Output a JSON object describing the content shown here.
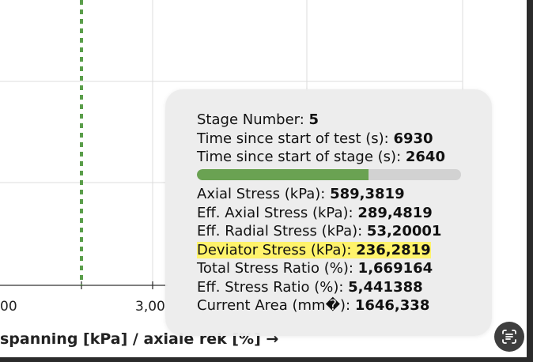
{
  "chart_data": {
    "type": "line",
    "x_tick_labels": [
      "00",
      "3,00"
    ],
    "xlabel_visible": "spanning [kPa] / axiale rek [%] →",
    "grid": true,
    "marker_line": {
      "style": "dashed",
      "color": "#5a9e4a"
    }
  },
  "tooltip": {
    "stage_number": {
      "label": "Stage Number: ",
      "value": "5"
    },
    "time_test": {
      "label": "Time since start of test (s): ",
      "value": "6930"
    },
    "time_stage": {
      "label": "Time since start of stage (s): ",
      "value": "2640"
    },
    "stage_progress": 0.65,
    "axial_stress": {
      "label": "Axial Stress (kPa): ",
      "value": "589,3819"
    },
    "eff_axial_stress": {
      "label": "Eff. Axial Stress (kPa): ",
      "value": "289,4819"
    },
    "eff_radial_stress": {
      "label": "Eff. Radial Stress (kPa): ",
      "value": "53,20001"
    },
    "deviator_stress": {
      "label": "Deviator Stress (kPa): ",
      "value": "236,2819"
    },
    "total_stress_ratio": {
      "label": "Total Stress Ratio (%): ",
      "value": "1,669164"
    },
    "eff_stress_ratio": {
      "label": "Eff. Stress Ratio (%): ",
      "value": "5,441388"
    },
    "current_area": {
      "label": "Current Area (mm�): ",
      "value": "1646,338"
    }
  },
  "colors": {
    "progress_fill": "#6aa252",
    "progress_track": "#d2d2d2",
    "highlight": "#fff36b",
    "marker_line": "#5a9e4a"
  },
  "fab": {
    "icon": "text-scan-icon"
  }
}
